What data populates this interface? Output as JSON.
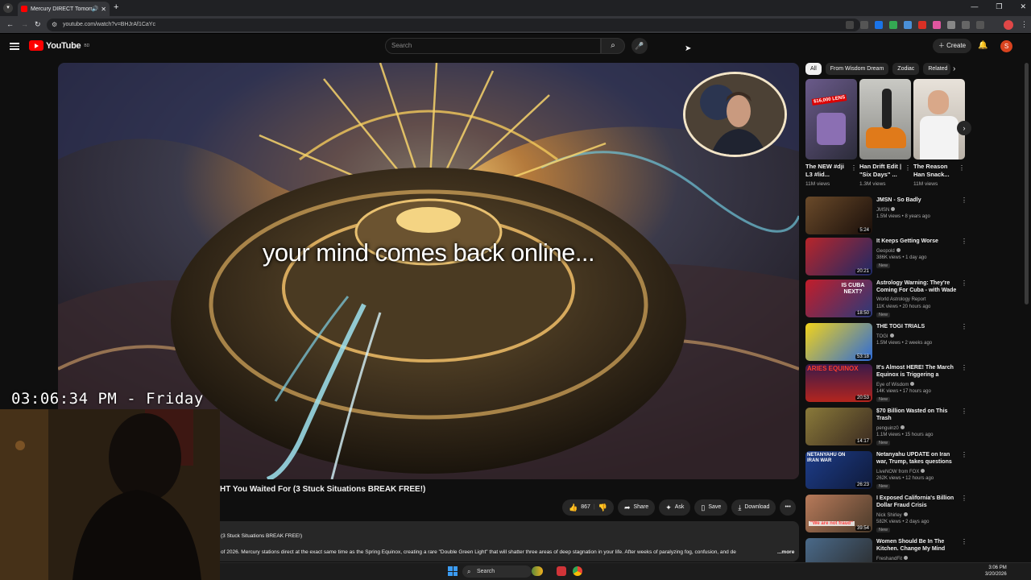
{
  "browser": {
    "tab_title": "Mercury DIRECT Tomorrow",
    "url": "youtube.com/watch?v=BHJrAf1CaYc"
  },
  "header": {
    "logo_text": "YouTube",
    "logo_region": "BD",
    "search_placeholder": "Search",
    "create_label": "Create",
    "avatar_letter": "S"
  },
  "player": {
    "caption": "your mind comes back online..."
  },
  "overlay": {
    "clock": "03:06:34 PM - Friday"
  },
  "video": {
    "title": "HT You Waited For (3 Stuck Situations BREAK FREE!)",
    "like_count": "867",
    "share_label": "Share",
    "ask_label": "Ask",
    "save_label": "Save",
    "download_label": "Download",
    "desc_line1": "(3 Stuck Situations BREAK FREE!)",
    "desc_line2": "of 2026. Mercury stations direct at the exact same time as the Spring Equinox, creating a rare \"Double Green Light\" that will shatter three areas of deep stagnation in your life. After weeks of paralyzing fog, confusion, and de",
    "more_label": "...more"
  },
  "taskbar": {
    "search_label": "Search",
    "time": "3:06 PM",
    "date": "3/20/2026"
  },
  "sidebar": {
    "chips": [
      "All",
      "From Wisdom Dream",
      "Zodiac",
      "Related"
    ],
    "shorts": [
      {
        "title": "The NEW #dji L3 #lid...",
        "views": "11M views",
        "overlay": "$16,000 LENS"
      },
      {
        "title": "Han Drift Edit | \"Six Days\" ...",
        "views": "1.3M views",
        "overlay": ""
      },
      {
        "title": "The Reason Han Snack...",
        "views": "11M views",
        "overlay": ""
      }
    ],
    "recommendations": [
      {
        "title": "JMSN - So Badly",
        "channel": "JMSN",
        "meta": "1.5M views • 8 years ago",
        "duration": "5:24",
        "badge": "",
        "thumb_text": ""
      },
      {
        "title": "It Keeps Getting Worse",
        "channel": "Geopold",
        "meta": "386K views • 1 day ago",
        "duration": "20:21",
        "badge": "New",
        "thumb_text": ""
      },
      {
        "title": "Astrology Warning: They're Coming For Cuba - with Wade ...",
        "channel": "World Astrology Report",
        "meta": "11K views • 20 hours ago",
        "duration": "18:50",
        "badge": "New",
        "thumb_text": "IS CUBA NEXT?"
      },
      {
        "title": "THE TOGI TRIALS",
        "channel": "TOGI",
        "meta": "1.5M views • 2 weeks ago",
        "duration": "53:18",
        "badge": "",
        "thumb_text": ""
      },
      {
        "title": "It's Almost HERE! The March Equinox is Triggering a MAJO...",
        "channel": "Eye of Wisdom",
        "meta": "14K views • 17 hours ago",
        "duration": "20:53",
        "badge": "New",
        "thumb_text": "ARIES EQUINOX"
      },
      {
        "title": "$70 Billion Wasted on This Trash",
        "channel": "penguinz0",
        "meta": "1.1M views • 15 hours ago",
        "duration": "14:17",
        "badge": "New",
        "thumb_text": ""
      },
      {
        "title": "Netanyahu UPDATE on Iran war, Trump, takes questions",
        "channel": "LiveNOW from FOX",
        "meta": "262K views • 12 hours ago",
        "duration": "26:23",
        "badge": "New",
        "thumb_text": "NETANYAHU ON IRAN WAR"
      },
      {
        "title": "I Exposed California's Billion Dollar Fraud Crisis",
        "channel": "Nick Shirley",
        "meta": "582K views • 2 days ago",
        "duration": "39:54",
        "badge": "New",
        "thumb_text": "\"We are not fraud\""
      },
      {
        "title": "Women Should Be In The Kitchen. Change My Mind Stre...",
        "channel": "FreshandFit",
        "meta": "",
        "duration": "",
        "badge": "",
        "thumb_text": ""
      }
    ]
  },
  "colors": {
    "youtube_red": "#ff0000",
    "background": "#0f0f0f",
    "pill": "#272727"
  }
}
